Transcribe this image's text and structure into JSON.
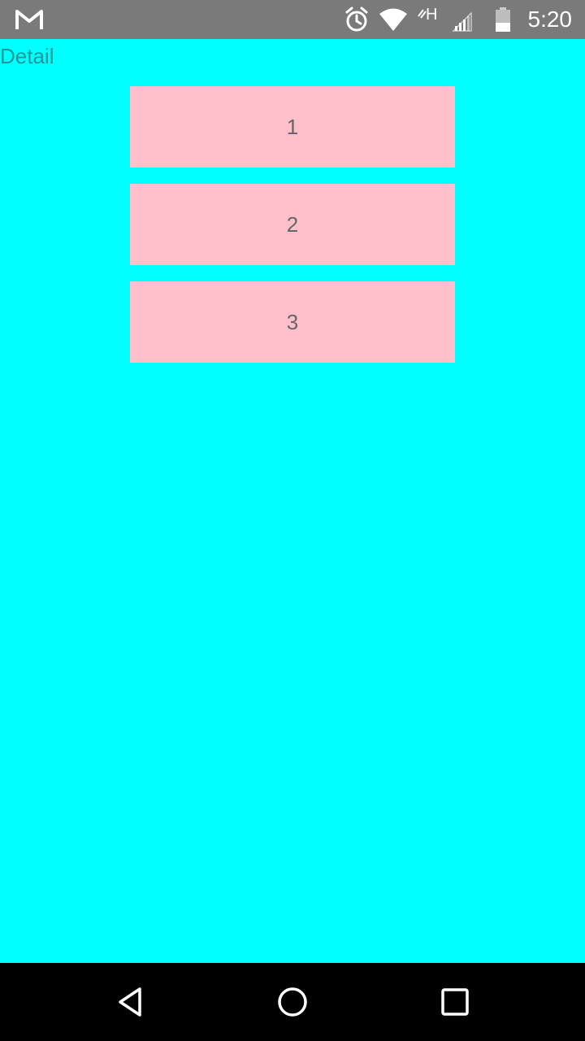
{
  "status_bar": {
    "time": "5:20",
    "icons": [
      "gmail-icon",
      "alarm-icon",
      "wifi-icon",
      "data-h-icon",
      "signal-icon",
      "battery-icon"
    ],
    "data_label": "H"
  },
  "page": {
    "title": "Detail",
    "background_color": "#00ffff",
    "cards": [
      {
        "label": "1"
      },
      {
        "label": "2"
      },
      {
        "label": "3"
      }
    ],
    "card_color": "#ffc0cb"
  },
  "nav_bar": {
    "buttons": [
      "back",
      "home",
      "recents"
    ]
  }
}
